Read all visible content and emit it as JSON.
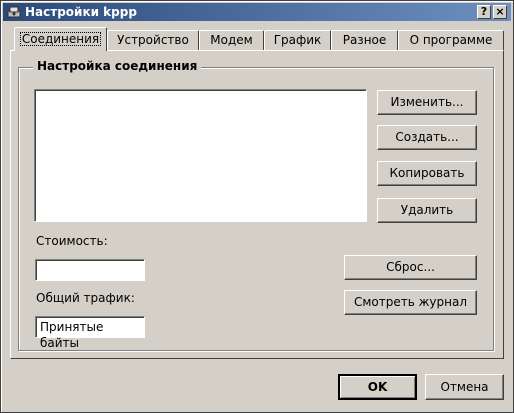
{
  "window": {
    "title": "Настройки kppp",
    "help_label": "?",
    "close_label": "×"
  },
  "tabs": [
    {
      "label": "Соединения",
      "active": true
    },
    {
      "label": "Устройство"
    },
    {
      "label": "Модем"
    },
    {
      "label": "График"
    },
    {
      "label": "Разное"
    },
    {
      "label": "О программе"
    }
  ],
  "connections": {
    "group_title": "Настройка соединения",
    "buttons": {
      "edit": "Изменить...",
      "create": "Создать...",
      "copy": "Копировать",
      "delete": "Удалить",
      "reset": "Сброс...",
      "view_log": "Смотреть журнал"
    },
    "cost_label": "Стоимость:",
    "cost_value": "",
    "traffic_label": "Общий трафик:",
    "traffic_value": "Принятые байты"
  },
  "dialog": {
    "ok": "OK",
    "cancel": "Отмена"
  },
  "colors": {
    "window_bg": "#d4d0c8",
    "title_start": "#2a4a7b",
    "title_end": "#6e90c0"
  }
}
